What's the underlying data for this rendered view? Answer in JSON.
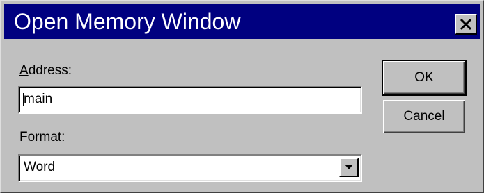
{
  "window": {
    "title": "Open Memory Window"
  },
  "close_button": {
    "icon": "close-icon"
  },
  "address": {
    "label_mnemonic": "A",
    "label_rest": "ddress:",
    "value": "main"
  },
  "format": {
    "label_mnemonic": "F",
    "label_rest": "ormat:",
    "selected": "Word",
    "dropdown_icon": "chevron-down-icon"
  },
  "buttons": {
    "ok_label": "OK",
    "cancel_label": "Cancel"
  },
  "colors": {
    "titlebar": "#000080",
    "face": "#c0c0c0",
    "field": "#ffffff"
  }
}
